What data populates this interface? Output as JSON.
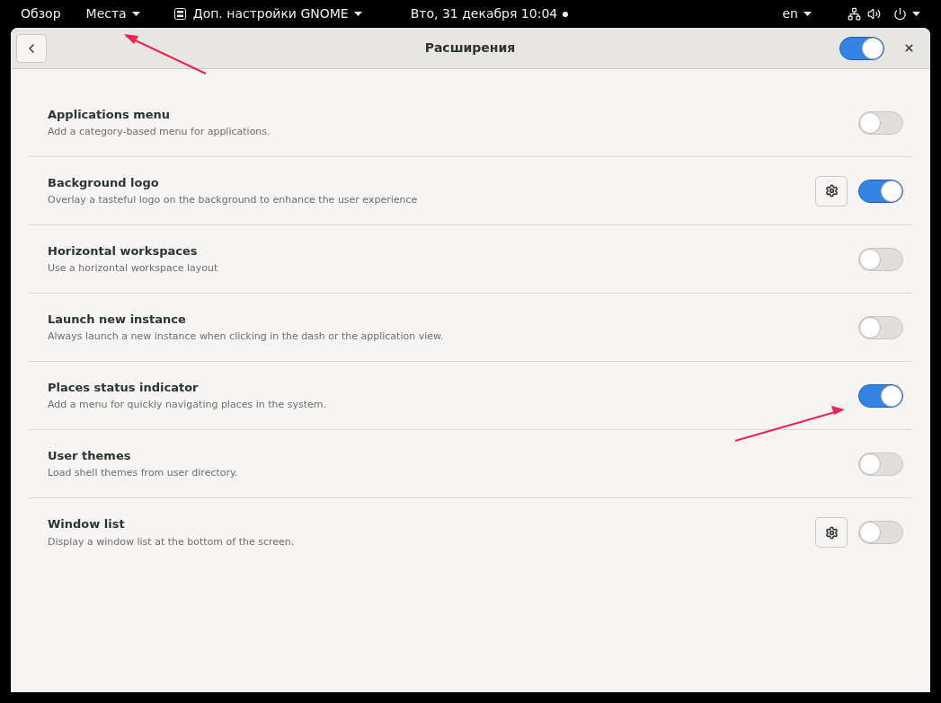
{
  "top_bar": {
    "overview": "Обзор",
    "places": "Места",
    "app_menu": "Доп. настройки GNOME",
    "clock": "Вто, 31 декабря  10:04",
    "notification_dot": true,
    "keyboard_layout": "en"
  },
  "window": {
    "title": "Расширения",
    "extensions_enabled": true
  },
  "extensions": [
    {
      "name": "Applications menu",
      "description": "Add a category-based menu for applications.",
      "on": false,
      "has_settings": false
    },
    {
      "name": "Background logo",
      "description": "Overlay a tasteful logo on the background to enhance the user experience",
      "on": true,
      "has_settings": true
    },
    {
      "name": "Horizontal workspaces",
      "description": "Use a horizontal workspace layout",
      "on": false,
      "has_settings": false
    },
    {
      "name": "Launch new instance",
      "description": "Always launch a new instance when clicking in the dash or the application view.",
      "on": false,
      "has_settings": false
    },
    {
      "name": "Places status indicator",
      "description": "Add a menu for quickly navigating places in the system.",
      "on": true,
      "has_settings": false
    },
    {
      "name": "User themes",
      "description": "Load shell themes from user directory.",
      "on": false,
      "has_settings": false
    },
    {
      "name": "Window list",
      "description": "Display a window list at the bottom of the screen.",
      "on": false,
      "has_settings": true
    }
  ]
}
